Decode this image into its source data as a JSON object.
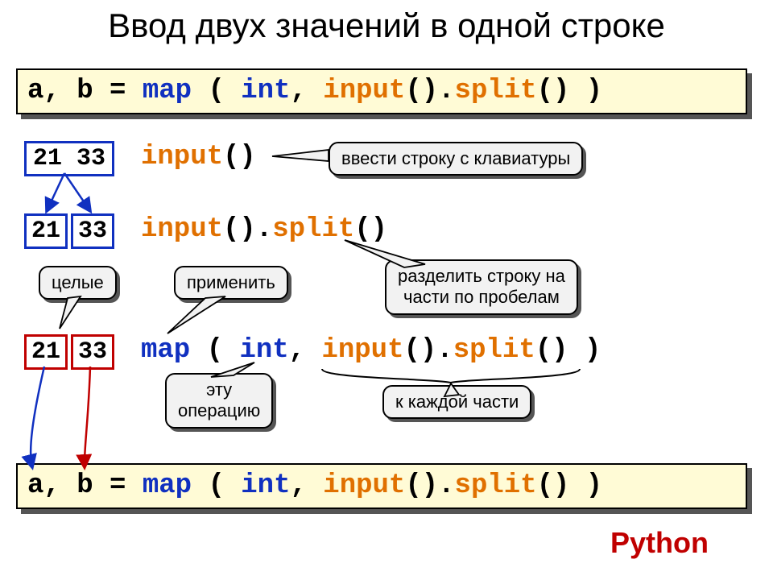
{
  "title": "Ввод двух значений в одной строке",
  "codebar1_tokens": [
    "a, b = ",
    "map",
    " ( ",
    "int",
    ", ",
    "input",
    "().",
    "split",
    "() )"
  ],
  "codebar1_classes": [
    "",
    "tk-blue",
    "",
    "tk-blue",
    "",
    "tk-orange",
    "",
    "tk-orange",
    ""
  ],
  "codebar2_tokens": [
    "a, b = ",
    "map",
    " ( ",
    "int",
    ", ",
    "input",
    "().",
    "split",
    "() )"
  ],
  "codebar2_classes": [
    "",
    "tk-blue",
    "",
    "tk-blue",
    "",
    "tk-orange",
    "",
    "tk-orange",
    ""
  ],
  "row1": {
    "box": "21 33",
    "code_tokens": [
      "input",
      "()"
    ],
    "code_classes": [
      "tk-orange",
      ""
    ]
  },
  "row2": {
    "box_a": "21",
    "box_b": "33",
    "code_tokens": [
      "input",
      "().",
      "split",
      "()"
    ],
    "code_classes": [
      "tk-orange",
      "",
      "tk-orange",
      ""
    ]
  },
  "row3": {
    "box_a": "21",
    "box_b": "33",
    "code_tokens": [
      "map",
      " ( ",
      "int",
      ", ",
      "input",
      "().",
      "split",
      "() )"
    ],
    "code_classes": [
      "tk-blue",
      "",
      "tk-blue",
      "",
      "tk-orange",
      "",
      "tk-orange",
      ""
    ]
  },
  "callouts": {
    "top_right": "ввести строку с клавиатуры",
    "split_explain_l1": "разделить строку на",
    "split_explain_l2": "части по пробелам",
    "whole": "целые",
    "apply": "применить",
    "this_op_l1": "эту",
    "this_op_l2": "операцию",
    "to_each": "к каждой части"
  },
  "python": "Python"
}
